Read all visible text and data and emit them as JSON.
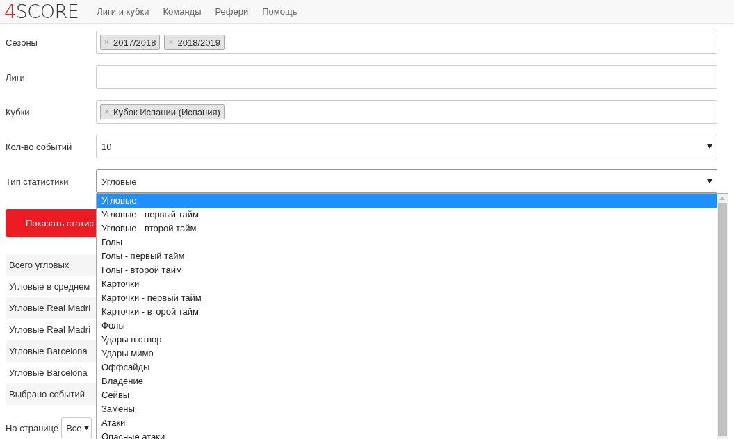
{
  "navbar": {
    "logo": {
      "accent": "4",
      "text": "SCORE"
    },
    "links": [
      "Лиги и кубки",
      "Команды",
      "Рефери",
      "Помощь"
    ]
  },
  "form": [
    {
      "kind": "tags",
      "label": "Сезоны",
      "tags": [
        "2017/2018",
        "2018/2019"
      ]
    },
    {
      "kind": "tags",
      "label": "Лиги"
    },
    {
      "kind": "tags",
      "label": "Кубки",
      "tags": [
        "Кубок Испании (Испания)"
      ]
    },
    {
      "kind": "select",
      "label": "Кол-во событий",
      "value": "10",
      "expanded": false
    },
    {
      "kind": "select",
      "label": "Тип статистики",
      "value": "Угловые",
      "expanded": true
    }
  ],
  "tag_remove": "×",
  "submit_button": "Показать статис",
  "stats": [
    "Всего угловых",
    "Угловые в среднем",
    "Угловые Real Madri",
    "Угловые Real Madri",
    "Угловые Barcelona",
    "Угловые Barcelona",
    "Выбрано событий"
  ],
  "per_page": {
    "label": "На странице",
    "value": "Все"
  },
  "dropdown_options": [
    {
      "label": "Угловые",
      "selected": true
    },
    {
      "label": "Угловые - первый тайм",
      "selected": false
    },
    {
      "label": "Угловые - второй тайм",
      "selected": false
    },
    {
      "label": "Голы",
      "selected": false
    },
    {
      "label": "Голы - первый тайм",
      "selected": false
    },
    {
      "label": "Голы - второй тайм",
      "selected": false
    },
    {
      "label": "Карточки",
      "selected": false
    },
    {
      "label": "Карточки - первый тайм",
      "selected": false
    },
    {
      "label": "Карточки - второй тайм",
      "selected": false
    },
    {
      "label": "Фолы",
      "selected": false
    },
    {
      "label": "Удары в створ",
      "selected": false
    },
    {
      "label": "Удары мимо",
      "selected": false
    },
    {
      "label": "Оффсайды",
      "selected": false
    },
    {
      "label": "Владение",
      "selected": false
    },
    {
      "label": "Сейвы",
      "selected": false
    },
    {
      "label": "Замены",
      "selected": false
    },
    {
      "label": "Атаки",
      "selected": false
    },
    {
      "label": "Опасные атаки",
      "selected": false
    }
  ]
}
